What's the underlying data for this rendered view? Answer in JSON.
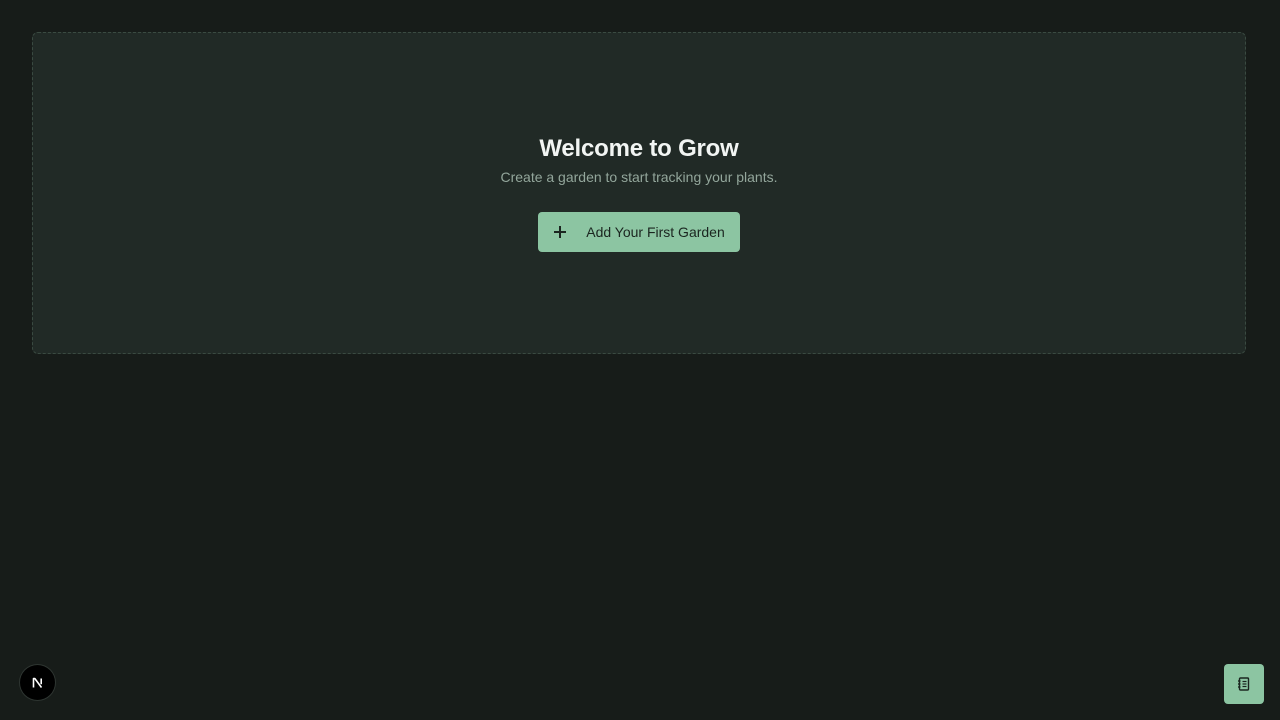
{
  "empty_state": {
    "title": "Welcome to Grow",
    "subtitle": "Create a garden to start tracking your plants.",
    "button_label": "Add Your First Garden",
    "button_icon": "plus-icon"
  },
  "dev_badge": {
    "icon": "nextjs-logo-icon"
  },
  "floating_button": {
    "icon": "notebook-icon"
  },
  "colors": {
    "background": "#171c19",
    "card": "#212a26",
    "accent": "#8cc5a2",
    "title": "#f2f5f3",
    "muted": "#93a69b"
  }
}
